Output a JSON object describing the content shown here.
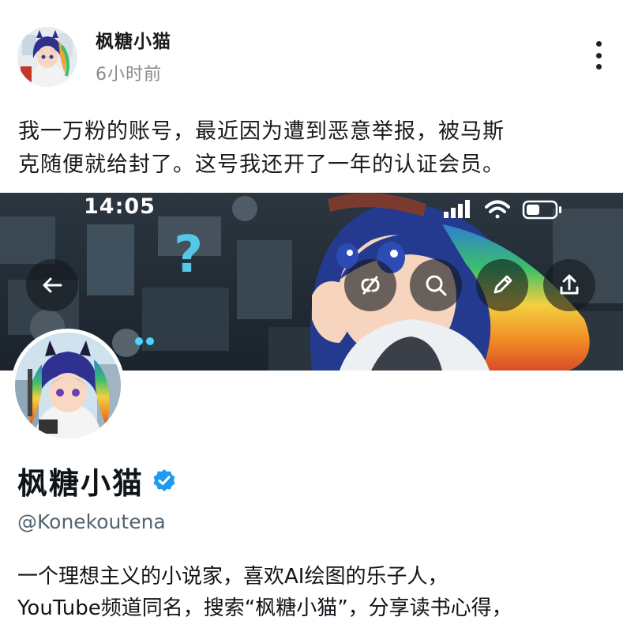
{
  "post": {
    "author_name": "枫糖小猫",
    "time": "6小时前",
    "text_lines": [
      "我一万粉的账号，最近因为遭到恶意举报，被马斯",
      "克随便就给封了。这号我还开了一年的认证会员。"
    ],
    "more_icon": "more-vertical-icon"
  },
  "screenshot": {
    "status_bar": {
      "time": "14:05",
      "icons": [
        "signal-icon",
        "wifi-icon",
        "battery-icon"
      ]
    },
    "banner_icons": [
      "back-arrow-icon",
      "unlink-icon",
      "search-icon",
      "edit-pencil-icon",
      "share-icon"
    ],
    "profile": {
      "name": "枫糖小猫",
      "verified_icon": "verified-badge-icon",
      "handle": "@Konekoutena",
      "bio_lines": [
        "一个理想主义的小说家，喜欢AI绘图的乐子人，",
        "YouTube频道同名，搜索“枫糖小猫”，分享读书心得，"
      ]
    }
  },
  "colors": {
    "verified": "#1d9bf0",
    "handle": "#536471",
    "time_gray": "#8a8a8a"
  }
}
